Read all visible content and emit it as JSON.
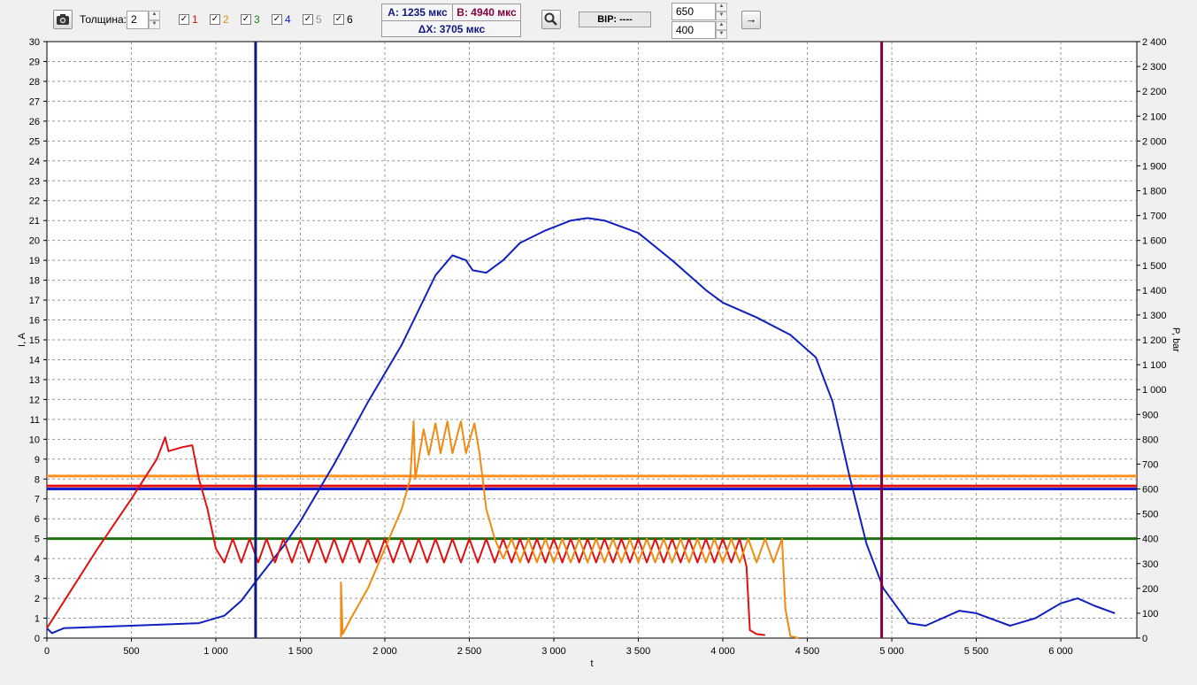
{
  "toolbar": {
    "camera_icon": "camera-icon",
    "thickness_label": "Толщина:",
    "thickness_value": "2",
    "channels": [
      {
        "label": "1",
        "checked": true,
        "color": "#e01010"
      },
      {
        "label": "2",
        "checked": true,
        "color": "#f08a10"
      },
      {
        "label": "3",
        "checked": true,
        "color": "#108a10"
      },
      {
        "label": "4",
        "checked": true,
        "color": "#1020c0"
      },
      {
        "label": "5",
        "checked": true,
        "color": "#909090"
      },
      {
        "label": "6",
        "checked": true,
        "color": "#000000"
      }
    ],
    "check_mark": "✓",
    "cursor_a": "A: 1235 мкс",
    "cursor_b": "B: 4940 мкс",
    "cursor_delta": "ΔX: 3705 мкс",
    "zoom_icon": "zoom-icon",
    "vr_label": "ВІР: ----",
    "input_top": "650",
    "input_bottom": "400",
    "go_label": "→"
  },
  "chart_data": {
    "type": "line",
    "xlabel": "t",
    "ylabel_left": "I, A",
    "ylabel_right": "P, bar",
    "xlim": [
      0,
      6450
    ],
    "ylim_left": [
      0,
      30
    ],
    "ylim_right": [
      0,
      2400
    ],
    "x_ticks": [
      0,
      500,
      1000,
      1500,
      2000,
      2500,
      3000,
      3500,
      4000,
      4500,
      5000,
      5500,
      6000
    ],
    "x_tick_labels": [
      "0",
      "500",
      "1 000",
      "1 500",
      "2 000",
      "2 500",
      "3 000",
      "3 500",
      "4 000",
      "4 500",
      "5 000",
      "5 500",
      "6 000"
    ],
    "y_left_ticks": [
      0,
      1,
      2,
      3,
      4,
      5,
      6,
      7,
      8,
      9,
      10,
      11,
      12,
      13,
      14,
      15,
      16,
      17,
      18,
      19,
      20,
      21,
      22,
      23,
      24,
      25,
      26,
      27,
      28,
      29,
      30
    ],
    "y_right_ticks": [
      0,
      100,
      200,
      300,
      400,
      500,
      600,
      700,
      800,
      900,
      1000,
      1100,
      1200,
      1300,
      1400,
      1500,
      1600,
      1700,
      1800,
      1900,
      2000,
      2100,
      2200,
      2300,
      2400
    ],
    "y_right_tick_labels": [
      "0",
      "100",
      "200",
      "300",
      "400",
      "500",
      "600",
      "700",
      "800",
      "900",
      "1 000",
      "1 100",
      "1 200",
      "1 300",
      "1 400",
      "1 500",
      "1 600",
      "1 700",
      "1 800",
      "1 900",
      "2 000",
      "2 100",
      "2 200",
      "2 300",
      "2 400"
    ],
    "grid": true,
    "cursors": [
      {
        "name": "A",
        "x": 1235,
        "color": "#101880"
      },
      {
        "name": "B",
        "x": 4940,
        "color": "#800040"
      }
    ],
    "hlines": [
      {
        "y": 8.15,
        "color": "#ff9020"
      },
      {
        "y": 7.65,
        "color": "#e01010"
      },
      {
        "y": 7.5,
        "color": "#1020d0"
      },
      {
        "y": 5.0,
        "color": "#207010"
      }
    ],
    "series": [
      {
        "axis": "right",
        "color": "#1020c0",
        "points": [
          [
            0,
            40
          ],
          [
            30,
            20
          ],
          [
            100,
            40
          ],
          [
            500,
            50
          ],
          [
            900,
            60
          ],
          [
            1050,
            90
          ],
          [
            1150,
            150
          ],
          [
            1250,
            240
          ],
          [
            1400,
            370
          ],
          [
            1500,
            470
          ],
          [
            1700,
            700
          ],
          [
            1900,
            950
          ],
          [
            2100,
            1180
          ],
          [
            2300,
            1460
          ],
          [
            2400,
            1540
          ],
          [
            2480,
            1520
          ],
          [
            2520,
            1480
          ],
          [
            2600,
            1470
          ],
          [
            2700,
            1520
          ],
          [
            2800,
            1590
          ],
          [
            2950,
            1640
          ],
          [
            3100,
            1680
          ],
          [
            3200,
            1690
          ],
          [
            3300,
            1680
          ],
          [
            3500,
            1630
          ],
          [
            3700,
            1520
          ],
          [
            3900,
            1400
          ],
          [
            4000,
            1350
          ],
          [
            4200,
            1290
          ],
          [
            4400,
            1220
          ],
          [
            4550,
            1130
          ],
          [
            4650,
            950
          ],
          [
            4750,
            650
          ],
          [
            4850,
            380
          ],
          [
            4950,
            200
          ],
          [
            5100,
            60
          ],
          [
            5200,
            50
          ],
          [
            5400,
            110
          ],
          [
            5500,
            100
          ],
          [
            5700,
            50
          ],
          [
            5850,
            80
          ],
          [
            6000,
            140
          ],
          [
            6100,
            160
          ],
          [
            6200,
            130
          ],
          [
            6320,
            100
          ]
        ]
      },
      {
        "axis": "left",
        "color": "#e01010",
        "points": [
          [
            0,
            0.5
          ],
          [
            150,
            2.5
          ],
          [
            300,
            4.5
          ],
          [
            500,
            7
          ],
          [
            650,
            9
          ],
          [
            700,
            10.1
          ],
          [
            720,
            9.4
          ],
          [
            800,
            9.6
          ],
          [
            860,
            9.7
          ],
          [
            900,
            8
          ],
          [
            950,
            6.5
          ],
          [
            1000,
            4.5
          ],
          [
            1050,
            3.8
          ],
          [
            1100,
            5
          ],
          [
            1150,
            3.8
          ],
          [
            1200,
            5
          ],
          [
            1250,
            3.8
          ],
          [
            1300,
            5
          ],
          [
            1350,
            3.8
          ],
          [
            1400,
            5
          ],
          [
            1450,
            3.8
          ],
          [
            1500,
            5
          ],
          [
            1550,
            3.8
          ],
          [
            1600,
            5
          ],
          [
            1650,
            3.8
          ],
          [
            1700,
            5
          ],
          [
            1750,
            3.8
          ],
          [
            1800,
            5
          ],
          [
            1850,
            3.8
          ],
          [
            1900,
            5
          ],
          [
            1950,
            3.8
          ],
          [
            2000,
            5
          ],
          [
            2050,
            3.8
          ],
          [
            2100,
            5
          ],
          [
            2150,
            3.8
          ],
          [
            2200,
            5
          ],
          [
            2250,
            3.8
          ],
          [
            2300,
            5
          ],
          [
            2350,
            3.8
          ],
          [
            2400,
            5
          ],
          [
            2450,
            3.8
          ],
          [
            2500,
            5
          ],
          [
            2550,
            3.8
          ],
          [
            2600,
            5
          ],
          [
            2650,
            3.8
          ],
          [
            2700,
            5
          ],
          [
            2750,
            3.8
          ],
          [
            2800,
            5
          ],
          [
            2850,
            3.8
          ],
          [
            2900,
            5
          ],
          [
            2950,
            3.8
          ],
          [
            3000,
            5
          ],
          [
            3050,
            3.8
          ],
          [
            3100,
            5
          ],
          [
            3150,
            3.8
          ],
          [
            3200,
            5
          ],
          [
            3250,
            3.8
          ],
          [
            3300,
            5
          ],
          [
            3350,
            3.8
          ],
          [
            3400,
            5
          ],
          [
            3450,
            3.8
          ],
          [
            3500,
            5
          ],
          [
            3550,
            3.8
          ],
          [
            3600,
            5
          ],
          [
            3650,
            3.8
          ],
          [
            3700,
            5
          ],
          [
            3750,
            3.8
          ],
          [
            3800,
            5
          ],
          [
            3850,
            3.8
          ],
          [
            3900,
            5
          ],
          [
            3950,
            3.8
          ],
          [
            4000,
            5
          ],
          [
            4050,
            3.8
          ],
          [
            4100,
            5
          ],
          [
            4140,
            3.6
          ],
          [
            4160,
            0.4
          ],
          [
            4200,
            0.2
          ],
          [
            4250,
            0.15
          ]
        ]
      },
      {
        "axis": "left",
        "color": "#f08a10",
        "points": [
          [
            1740,
            0
          ],
          [
            1740,
            2.8
          ],
          [
            1750,
            0.2
          ],
          [
            1800,
            1
          ],
          [
            1900,
            2.5
          ],
          [
            2000,
            4.5
          ],
          [
            2100,
            6.5
          ],
          [
            2150,
            8
          ],
          [
            2170,
            10.9
          ],
          [
            2180,
            8
          ],
          [
            2230,
            10.5
          ],
          [
            2260,
            9.2
          ],
          [
            2300,
            10.8
          ],
          [
            2330,
            9.3
          ],
          [
            2370,
            10.9
          ],
          [
            2400,
            9.3
          ],
          [
            2450,
            10.9
          ],
          [
            2480,
            9.3
          ],
          [
            2530,
            10.8
          ],
          [
            2560,
            9.3
          ],
          [
            2600,
            6.5
          ],
          [
            2650,
            5
          ],
          [
            2700,
            4
          ],
          [
            2750,
            5
          ],
          [
            2800,
            3.8
          ],
          [
            2850,
            5
          ],
          [
            2900,
            3.8
          ],
          [
            2950,
            5
          ],
          [
            3000,
            3.8
          ],
          [
            3050,
            5
          ],
          [
            3100,
            3.8
          ],
          [
            3150,
            5
          ],
          [
            3200,
            3.8
          ],
          [
            3250,
            5
          ],
          [
            3300,
            3.8
          ],
          [
            3350,
            5
          ],
          [
            3400,
            3.8
          ],
          [
            3450,
            5
          ],
          [
            3500,
            3.8
          ],
          [
            3550,
            5
          ],
          [
            3600,
            3.8
          ],
          [
            3650,
            5
          ],
          [
            3700,
            3.8
          ],
          [
            3750,
            5
          ],
          [
            3800,
            3.8
          ],
          [
            3850,
            5
          ],
          [
            3900,
            3.8
          ],
          [
            3950,
            5
          ],
          [
            4000,
            3.8
          ],
          [
            4050,
            5
          ],
          [
            4100,
            3.8
          ],
          [
            4150,
            5
          ],
          [
            4200,
            3.8
          ],
          [
            4250,
            5
          ],
          [
            4300,
            3.8
          ],
          [
            4350,
            5
          ],
          [
            4370,
            1.5
          ],
          [
            4400,
            0.1
          ],
          [
            4450,
            0
          ]
        ]
      }
    ]
  }
}
